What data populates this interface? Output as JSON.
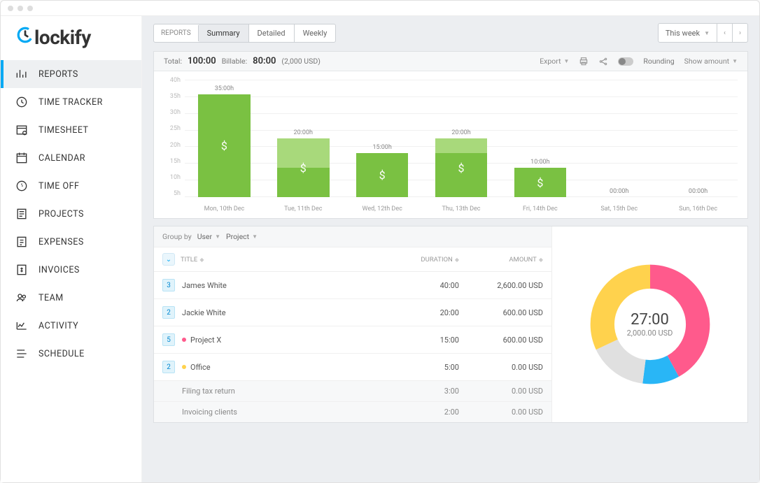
{
  "logo": "lockify",
  "colors": {
    "accent": "#03A9F4",
    "bar": "#7ac142",
    "barLight": "#a8d97b"
  },
  "nav": [
    {
      "label": "REPORTS",
      "icon": "bar-chart-icon"
    },
    {
      "label": "TIME TRACKER",
      "icon": "clock-icon"
    },
    {
      "label": "TIMESHEET",
      "icon": "timesheet-icon"
    },
    {
      "label": "CALENDAR",
      "icon": "calendar-icon"
    },
    {
      "label": "TIME OFF",
      "icon": "time-off-icon"
    },
    {
      "label": "PROJECTS",
      "icon": "projects-icon"
    },
    {
      "label": "EXPENSES",
      "icon": "expenses-icon"
    },
    {
      "label": "INVOICES",
      "icon": "invoices-icon"
    },
    {
      "label": "TEAM",
      "icon": "team-icon"
    },
    {
      "label": "ACTIVITY",
      "icon": "activity-icon"
    },
    {
      "label": "SCHEDULE",
      "icon": "schedule-icon"
    }
  ],
  "tabs": {
    "label": "REPORTS",
    "items": [
      "Summary",
      "Detailed",
      "Weekly"
    ],
    "active": 0
  },
  "dateRange": {
    "label": "This week"
  },
  "totals": {
    "totalLabel": "Total:",
    "total": "100:00",
    "billableLabel": "Billable:",
    "billable": "80:00",
    "billableAmt": "(2,000 USD)"
  },
  "panelActions": {
    "export": "Export",
    "rounding": "Rounding",
    "show": "Show amount"
  },
  "chart_data": {
    "type": "bar",
    "ylabel": "",
    "xlabel": "",
    "yticks": [
      "40h",
      "35h",
      "30h",
      "25h",
      "20h",
      "15h",
      "10h",
      "5h"
    ],
    "ymax": 40,
    "categories": [
      "Mon, 10th Dec",
      "Tue, 11th Dec",
      "Wed, 12th Dec",
      "Thu, 13th Dec",
      "Fri, 14th Dec",
      "Sat, 15th Dec",
      "Sun, 16th Dec"
    ],
    "series": [
      {
        "name": "billable",
        "values": [
          35,
          10,
          15,
          15,
          10,
          0,
          0
        ]
      },
      {
        "name": "nonbillable",
        "values": [
          0,
          10,
          0,
          5,
          0,
          0,
          0
        ]
      }
    ],
    "labels": [
      "35:00h",
      "20:00h",
      "15:00h",
      "20:00h",
      "10:00h",
      "00:00h",
      "00:00h"
    ]
  },
  "groupBy": {
    "label": "Group by",
    "g1": "User",
    "g2": "Project"
  },
  "tableHeaders": {
    "title": "TITLE",
    "duration": "DURATION",
    "amount": "AMOUNT"
  },
  "rows": [
    {
      "badge": "3",
      "title": "James White",
      "duration": "40:00",
      "amount": "2,600.00 USD"
    },
    {
      "badge": "2",
      "title": "Jackie White",
      "duration": "20:00",
      "amount": "600.00 USD"
    },
    {
      "badge": "5",
      "title": "Project X",
      "dot": "#ff5a8c",
      "duration": "15:00",
      "amount": "600.00 USD"
    },
    {
      "badge": "2",
      "title": "Office",
      "dot": "#ffd24d",
      "duration": "5:00",
      "amount": "0.00 USD"
    },
    {
      "sub": true,
      "title": "Filing tax return",
      "duration": "3:00",
      "amount": "0.00 USD"
    },
    {
      "sub": true,
      "title": "Invoicing clients",
      "duration": "2:00",
      "amount": "0.00 USD"
    }
  ],
  "donut": {
    "centerTime": "27:00",
    "centerAmt": "2,000.00 USD",
    "slices": [
      {
        "color": "#ff5a8c",
        "frac": 0.42
      },
      {
        "color": "#29b6f6",
        "frac": 0.1
      },
      {
        "color": "#e0e0e0",
        "frac": 0.16
      },
      {
        "color": "#ffd24d",
        "frac": 0.32
      }
    ]
  }
}
